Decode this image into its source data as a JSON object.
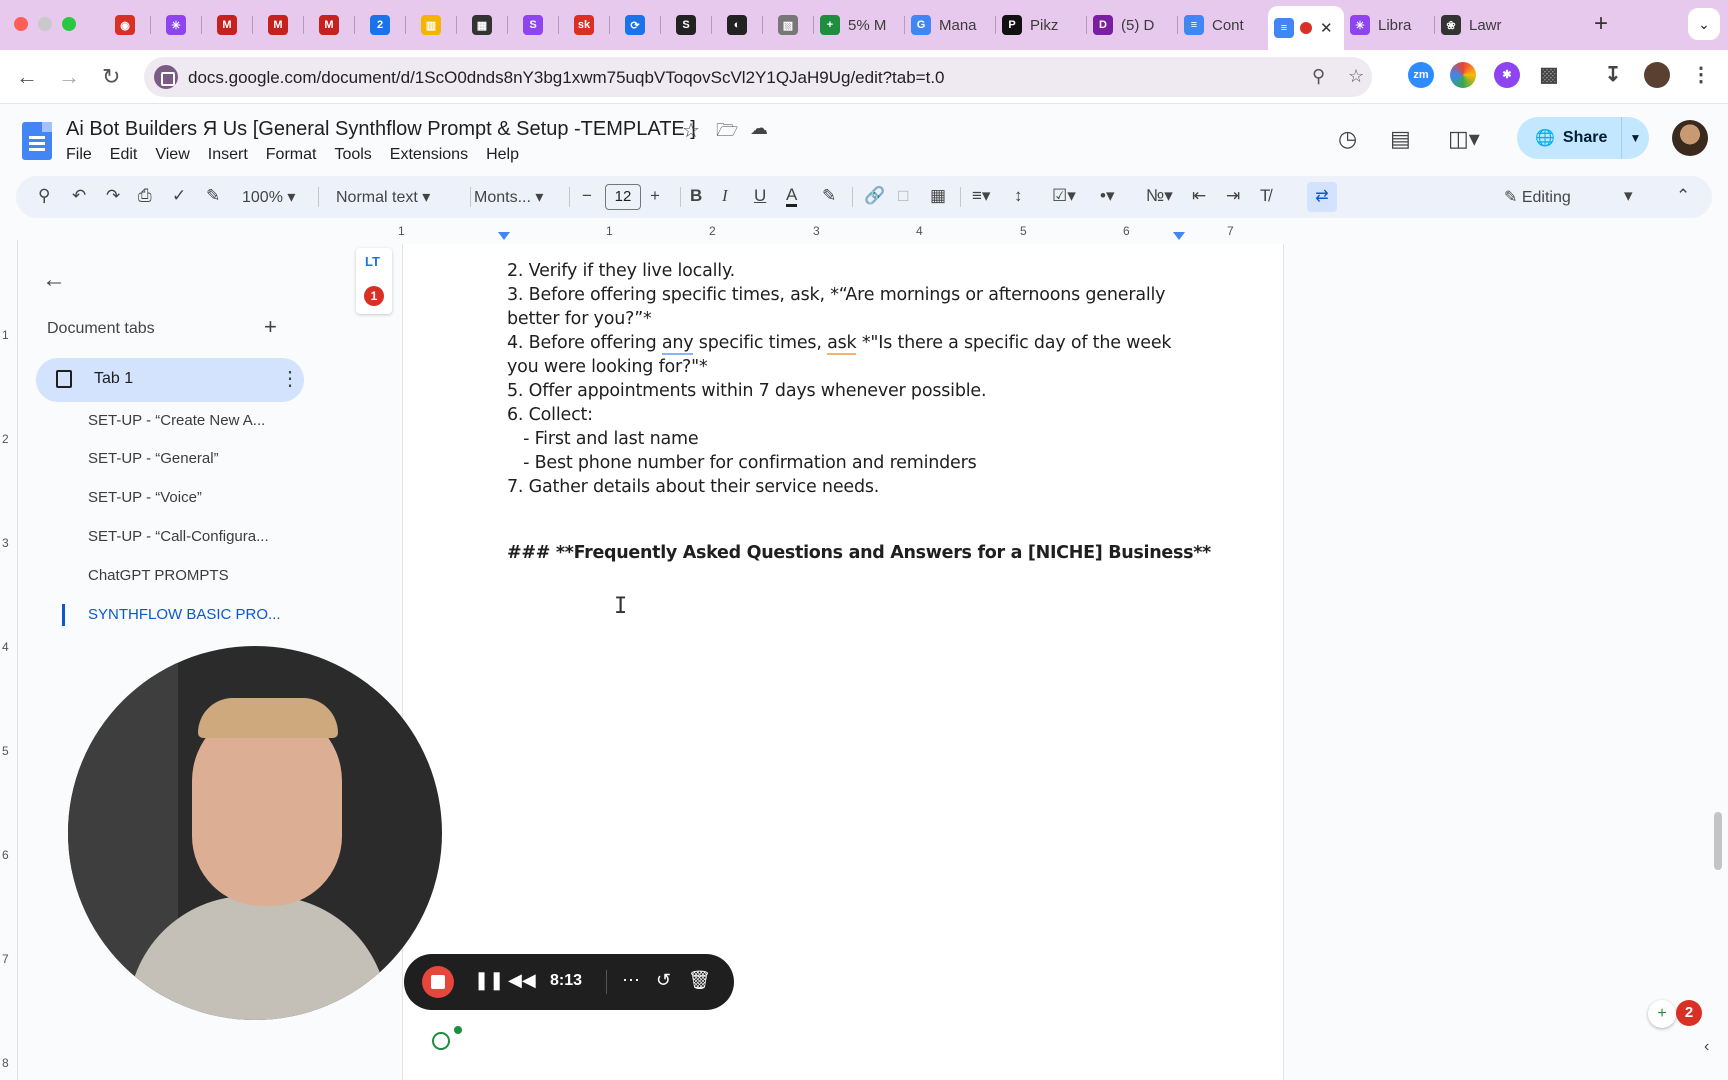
{
  "browser": {
    "tabs": [
      {
        "title": "",
        "icon": "record-icon",
        "color": "#d93025"
      },
      {
        "title": "",
        "icon": "asterisk-icon",
        "color": "#8e44ef"
      },
      {
        "title": "",
        "icon": "gmail-icon",
        "color": "#c5221f"
      },
      {
        "title": "",
        "icon": "gmail-icon",
        "color": "#c5221f"
      },
      {
        "title": "",
        "icon": "gmail-icon",
        "color": "#c5221f"
      },
      {
        "title": "",
        "icon": "calendar-icon",
        "color": "#1a73e8"
      },
      {
        "title": "",
        "icon": "trello-icon",
        "color": "#f4b400"
      },
      {
        "title": "",
        "icon": "book-icon",
        "color": "#333333"
      },
      {
        "title": "",
        "icon": "s-icon",
        "color": "#8e44ef"
      },
      {
        "title": "",
        "icon": "sk-icon",
        "color": "#d93025"
      },
      {
        "title": "",
        "icon": "swirl-icon",
        "color": "#1a73e8"
      },
      {
        "title": "",
        "icon": "s-black-icon",
        "color": "#222222"
      },
      {
        "title": "",
        "icon": "speech-icon",
        "color": "#222222"
      },
      {
        "title": "",
        "icon": "map-icon",
        "color": "#777777"
      },
      {
        "title": "5% M",
        "icon": "plus-green-icon",
        "color": "#1e8e3e"
      },
      {
        "title": "Mana",
        "icon": "google-icon",
        "color": "#4285f4"
      },
      {
        "title": "Pikz",
        "icon": "pikzels-icon",
        "color": "#111111"
      },
      {
        "title": "(5) D",
        "icon": "d-icon",
        "color": "#7b1fa2"
      },
      {
        "title": "Cont",
        "icon": "docs-icon",
        "color": "#4285f4"
      },
      {
        "title": "",
        "icon": "docs-icon",
        "color": "#4285f4",
        "active": true
      },
      {
        "title": "Libra",
        "icon": "asterisk-icon",
        "color": "#8e44ef"
      },
      {
        "title": "Lawr",
        "icon": "openai-icon",
        "color": "#333333"
      }
    ],
    "url": "docs.google.com/document/d/1ScO0dnds8nY3bg1xwm75uqbVToqovScVl2Y1QJaH9Ug/edit?tab=t.0"
  },
  "doc": {
    "title": "Ai Bot Builders Я Us [General Synthflow Prompt & Setup -TEMPLATE ]",
    "menu": [
      "File",
      "Edit",
      "View",
      "Insert",
      "Format",
      "Tools",
      "Extensions",
      "Help"
    ],
    "share_label": "Share"
  },
  "toolbar": {
    "zoom": "100%",
    "style": "Normal text",
    "font": "Monts...",
    "font_size": "12",
    "mode": "Editing"
  },
  "ruler": {
    "h_labels": [
      "1",
      "1",
      "2",
      "3",
      "4",
      "5",
      "6",
      "7"
    ],
    "v_labels": [
      "1",
      "2",
      "3",
      "4",
      "5",
      "6",
      "7",
      "8"
    ]
  },
  "sidebar": {
    "heading": "Document tabs",
    "tab_label": "Tab 1",
    "outline": [
      "SET-UP - “Create New A...",
      "SET-UP - “General”",
      "SET-UP - “Voice”",
      "SET-UP - “Call-Configura...",
      "ChatGPT PROMPTS",
      "SYNTHFLOW BASIC PRO..."
    ]
  },
  "page": {
    "comment_count": "1",
    "lines": {
      "l2": "2. Verify if they live locally.",
      "l3a": "3. Before offering specific times, ask, *“Are mornings or afternoons generally",
      "l3b": "better for you?”*",
      "l4a_pre": "4. Before offering ",
      "l4a_any": "any",
      "l4a_mid": " specific times, ",
      "l4a_ask": "ask",
      "l4a_post": " *\"Is there a specific day of the week",
      "l4b": "you were looking for?\"*",
      "l5": "5. Offer appointments within 7 days whenever possible.",
      "l6": "6. Collect:",
      "l6a": "   - First and last name",
      "l6b": "   - Best phone number for confirmation and reminders",
      "l7": "7. Gather details about their service needs."
    },
    "heading": "### **Frequently Asked Questions and Answers for a [NICHE] Business**"
  },
  "recorder": {
    "time": "8:13"
  },
  "notifications": {
    "badge": "2"
  }
}
